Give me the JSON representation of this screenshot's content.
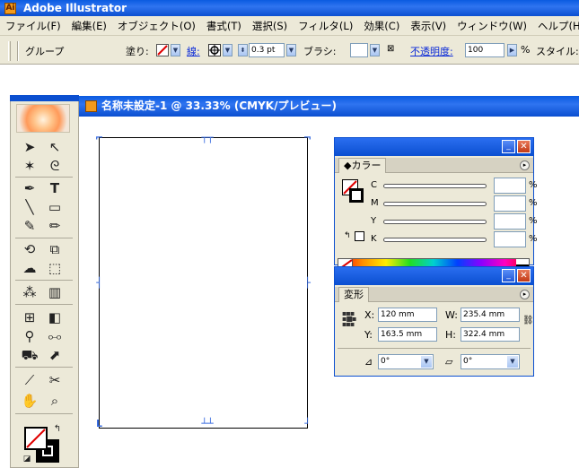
{
  "app": {
    "title": "Adobe Illustrator",
    "icon": "app-logo-icon"
  },
  "menu": {
    "items": [
      "ファイル(F)",
      "編集(E)",
      "オブジェクト(O)",
      "書式(T)",
      "選択(S)",
      "フィルタ(L)",
      "効果(C)",
      "表示(V)",
      "ウィンドウ(W)",
      "ヘルプ(H)"
    ]
  },
  "control_bar": {
    "group_label": "グループ",
    "fill_label": "塗り:",
    "stroke_label": "線:",
    "stroke_weight": "0.3 pt",
    "brush_label": "ブラシ:",
    "opacity_label": "不透明度:",
    "opacity_value": "100",
    "opacity_unit": "%",
    "style_label": "スタイル:"
  },
  "document": {
    "title": "名称未設定-1 @ 33.33% (CMYK/プレビュー)"
  },
  "toolbox": {
    "tools": [
      "selection-tool-icon",
      "direct-selection-tool-icon",
      "magic-wand-tool-icon",
      "lasso-tool-icon",
      "pen-tool-icon",
      "type-tool-icon",
      "line-tool-icon",
      "rectangle-tool-icon",
      "paintbrush-tool-icon",
      "pencil-tool-icon",
      "rotate-tool-icon",
      "scale-tool-icon",
      "warp-tool-icon",
      "free-transform-tool-icon",
      "symbol-sprayer-tool-icon",
      "column-graph-tool-icon",
      "mesh-tool-icon",
      "gradient-tool-icon",
      "eyedropper-tool-icon",
      "blend-tool-icon",
      "live-paint-tool-icon",
      "live-paint-selection-tool-icon",
      "slice-tool-icon",
      "scissors-tool-icon",
      "hand-tool-icon",
      "zoom-tool-icon"
    ]
  },
  "color_panel": {
    "tab_label": "◆カラー",
    "channels": [
      {
        "label": "C",
        "value": "",
        "unit": "%"
      },
      {
        "label": "M",
        "value": "",
        "unit": "%"
      },
      {
        "label": "Y",
        "value": "",
        "unit": "%"
      },
      {
        "label": "K",
        "value": "",
        "unit": "%"
      }
    ]
  },
  "transform_panel": {
    "tab_label": "変形",
    "x_label": "X:",
    "x_value": "120 mm",
    "y_label": "Y:",
    "y_value": "163.5 mm",
    "w_label": "W:",
    "w_value": "235.4 mm",
    "h_label": "H:",
    "h_value": "322.4 mm",
    "rotate_value": "0°",
    "shear_value": "0°"
  },
  "colors": {
    "accent_blue": "#0b4fd0",
    "handle_blue": "#3a6de0",
    "chrome": "#ece9d8"
  }
}
